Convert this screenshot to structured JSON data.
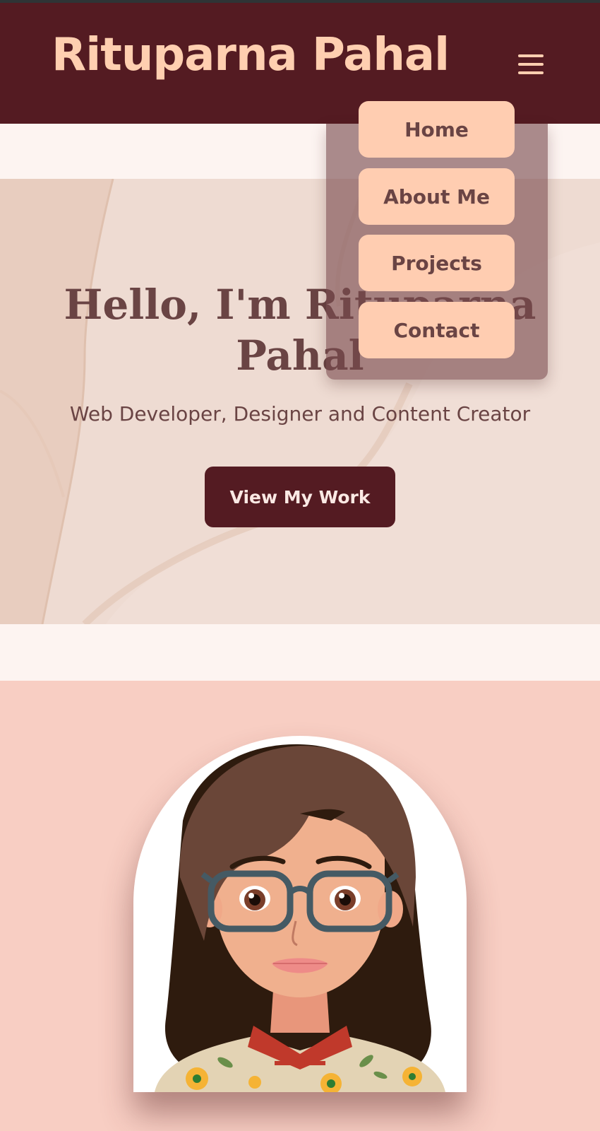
{
  "header": {
    "brand": "Rituparna Pahal",
    "menu_icon": "hamburger-menu-icon"
  },
  "nav_menu": {
    "items": [
      {
        "label": "Home"
      },
      {
        "label": "About Me"
      },
      {
        "label": "Projects"
      },
      {
        "label": "Contact"
      }
    ]
  },
  "hero": {
    "title": "Hello, I'm Rituparna Pahal",
    "subtitle": "Web Developer, Designer and Content Creator",
    "cta_label": "View My Work"
  },
  "about": {
    "portrait": "cartoon-avatar-image"
  },
  "colors": {
    "header_bg": "#541b22",
    "brand_text": "#ffcfb0",
    "menu_button_bg": "#ffcdb1",
    "hero_bg": "#eedbd2",
    "text_brown": "#6a4444",
    "about_bg": "#f8cec3"
  }
}
